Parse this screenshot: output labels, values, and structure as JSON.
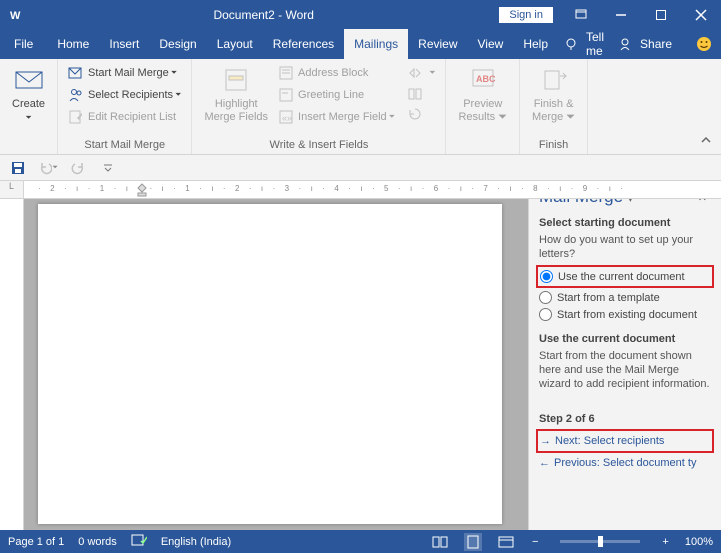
{
  "titlebar": {
    "doc_title": "Document2 - Word",
    "signin": "Sign in"
  },
  "menubar": {
    "file": "File",
    "tabs": [
      "Home",
      "Insert",
      "Design",
      "Layout",
      "References",
      "Mailings",
      "Review",
      "View",
      "Help"
    ],
    "active_tab": "Mailings",
    "tellme": "Tell me",
    "share": "Share"
  },
  "ribbon": {
    "create": {
      "label": "Create",
      "dd": "⏷"
    },
    "start_merge_group": {
      "start_mail_merge": "Start Mail Merge",
      "select_recipients": "Select Recipients",
      "edit_recipient": "Edit Recipient List",
      "group_label": "Start Mail Merge"
    },
    "highlight": {
      "line1": "Highlight",
      "line2": "Merge Fields"
    },
    "write_insert": {
      "address_block": "Address Block",
      "greeting_line": "Greeting Line",
      "insert_merge_field": "Insert Merge Field",
      "group_label": "Write & Insert Fields"
    },
    "preview": {
      "line1": "Preview",
      "line2": "Results"
    },
    "finish": {
      "line1": "Finish &",
      "line2": "Merge",
      "group_label": "Finish"
    }
  },
  "ruler": {
    "corner": "L",
    "h": "· 2 · ı · 1 · ı ·   · ı · 1 · ı · 2 · ı · 3 · ı · 4 · ı · 5 · ı · 6 · ı · 7 · ı · 8 · ı · 9 · ı ·"
  },
  "task_pane": {
    "title": "Mail Merge",
    "s1_heading": "Select starting document",
    "s1_q": "How do you want to set up your letters?",
    "opt1": "Use the current document",
    "opt2": "Start from a template",
    "opt3": "Start from existing document",
    "s2_heading": "Use the current document",
    "s2_body": "Start from the document shown here and use the Mail Merge wizard to add recipient information.",
    "step_heading": "Step 2 of 6",
    "next": "Next: Select recipients",
    "prev": "Previous: Select document ty"
  },
  "statusbar": {
    "page": "Page 1 of 1",
    "words": "0 words",
    "lang": "English (India)",
    "zoom": "100%",
    "minus": "−",
    "plus": "+"
  }
}
